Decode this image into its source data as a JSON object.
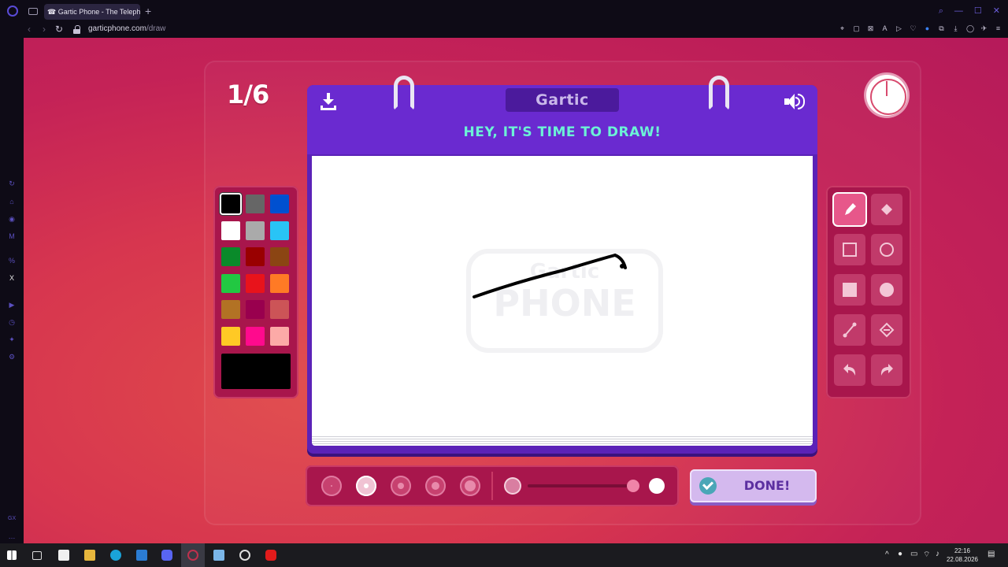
{
  "browser": {
    "tab_title": "☎ Gartic Phone - The Telepho",
    "tab_add": "+",
    "url_domain": "garticphone.com",
    "url_path": "/draw"
  },
  "game": {
    "round_counter": "1/6",
    "logo_text": "Gartic",
    "heading": "HEY, IT'S TIME TO DRAW!",
    "watermark_top": "Gartic",
    "watermark_bottom": "PHONE",
    "done_label": "DONE!",
    "palette": {
      "colors": [
        "#000000",
        "#666666",
        "#0050d0",
        "#ffffff",
        "#aaaaaa",
        "#29c4f6",
        "#0a8a2a",
        "#990000",
        "#8b4513",
        "#22c842",
        "#e8131b",
        "#ff7a25",
        "#b27224",
        "#99004e",
        "#cc5457",
        "#ffc925",
        "#ff0a8d",
        "#fcaaa7"
      ],
      "selected_index": 0,
      "current_color": "#000000"
    },
    "tools": [
      "pen",
      "fill-bucket",
      "rectangle-outline",
      "ellipse-outline",
      "rectangle-filled",
      "ellipse-filled",
      "line",
      "eraser-fill",
      "undo",
      "redo"
    ],
    "active_tool": "pen",
    "brush_sizes": 5,
    "active_brush_size": 2
  },
  "taskbar": {
    "time": "22:16",
    "date": "22.08.2026"
  }
}
